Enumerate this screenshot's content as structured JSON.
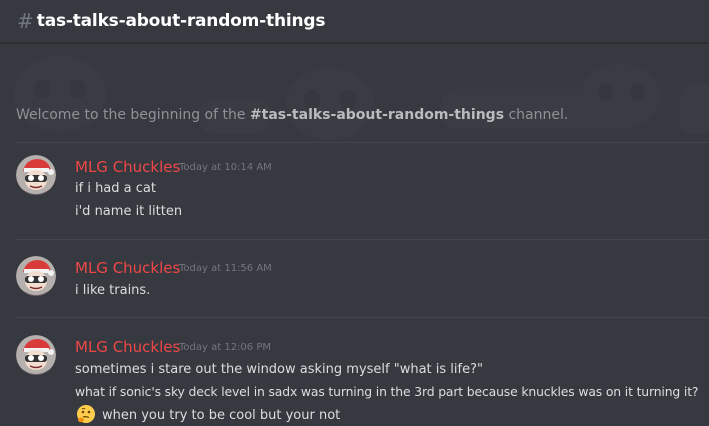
{
  "header": {
    "hash_symbol": "#",
    "channel_name": "tas-talks-about-random-things"
  },
  "welcome": {
    "prefix": "Welcome to the beginning of the ",
    "channel": "#tas-talks-about-random-things",
    "suffix": " channel."
  },
  "messages": [
    {
      "username": "MLG Chuckles",
      "timestamp": "Today at 10:14 AM",
      "lines": [
        "if i had a cat",
        "i'd name it litten"
      ]
    },
    {
      "username": "MLG Chuckles",
      "timestamp": "Today at 11:56 AM",
      "lines": [
        "i like trains."
      ]
    },
    {
      "username": "MLG Chuckles",
      "timestamp": "Today at 12:06 PM",
      "lines": [
        "sometimes i stare out the window asking myself \"what is life?\"",
        "what if sonic's sky deck level in sadx was turning in the 3rd part because knuckles was on it turning it?",
        "when you try to be cool but your not"
      ],
      "emoji": "thinking-emoji"
    }
  ],
  "colors": {
    "background": "#36393f",
    "username": "#f04747",
    "message_text": "#dcddde",
    "timestamp": "#72767d",
    "header_text": "#ffffff"
  }
}
